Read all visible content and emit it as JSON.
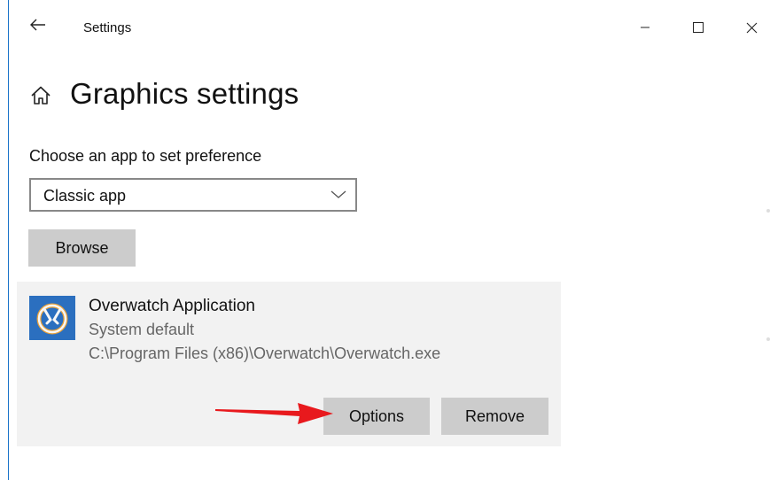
{
  "window": {
    "title": "Settings"
  },
  "page": {
    "title": "Graphics settings"
  },
  "preference": {
    "label": "Choose an app to set preference",
    "dropdown_value": "Classic app",
    "browse_label": "Browse"
  },
  "app_entry": {
    "name": "Overwatch Application",
    "preference": "System default",
    "path": "C:\\Program Files (x86)\\Overwatch\\Overwatch.exe",
    "options_label": "Options",
    "remove_label": "Remove"
  },
  "icons": {
    "back": "back-arrow-icon",
    "minimize": "minimize-icon",
    "maximize": "maximize-icon",
    "close": "close-icon",
    "home": "home-icon",
    "chevron": "chevron-down-icon",
    "app": "overwatch-icon"
  },
  "colors": {
    "button_bg": "#cccccc",
    "card_bg": "#f2f2f2",
    "accent": "#1a73c9",
    "annotation_arrow": "#e8191d"
  }
}
